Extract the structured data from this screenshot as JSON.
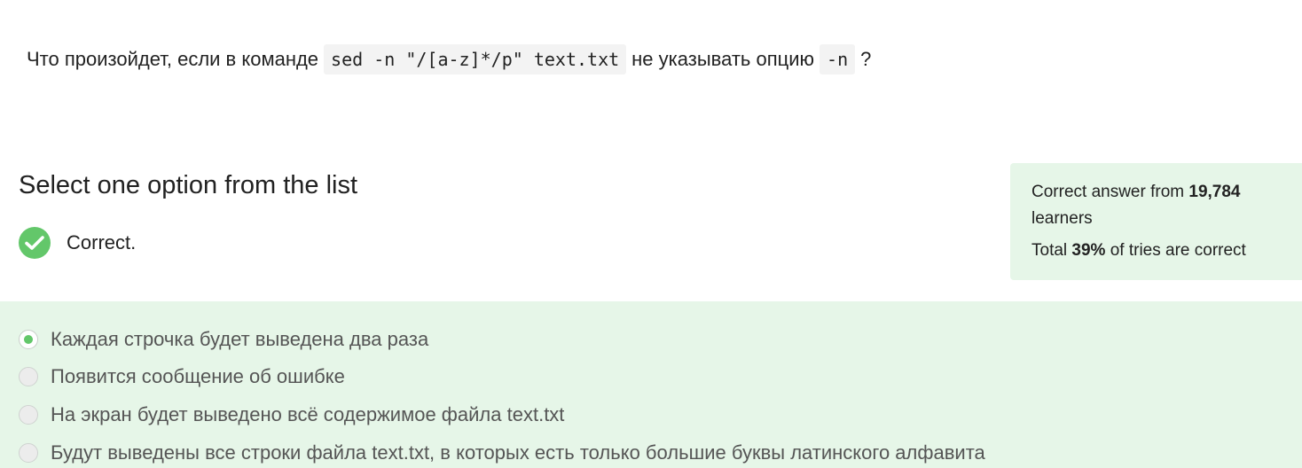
{
  "question": {
    "text_before": "Что произойдет, если в команде",
    "code_command": "sed -n \"/[a-z]*/p\" text.txt",
    "text_middle": "не указывать опцию",
    "code_option": "-n",
    "text_end": "?"
  },
  "select_title": "Select one option from the list",
  "status": {
    "icon": "check-icon",
    "text": "Correct.",
    "color": "#63c76a"
  },
  "stats": {
    "line1_prefix": "Correct answer from ",
    "learners_count": "19,784",
    "line1_suffix": " learners",
    "line2_prefix": "Total ",
    "percent": "39%",
    "line2_suffix": " of tries are correct",
    "background": "#e6f6e8"
  },
  "options": [
    {
      "label": "Каждая строчка будет выведена два раза",
      "selected": true
    },
    {
      "label": "Появится сообщение об ошибке",
      "selected": false
    },
    {
      "label": "На экран будет выведено всё содержимое файла text.txt",
      "selected": false
    },
    {
      "label": "Будут выведены все строки файла text.txt, в которых есть только большие буквы латинского алфавита",
      "selected": false
    }
  ]
}
